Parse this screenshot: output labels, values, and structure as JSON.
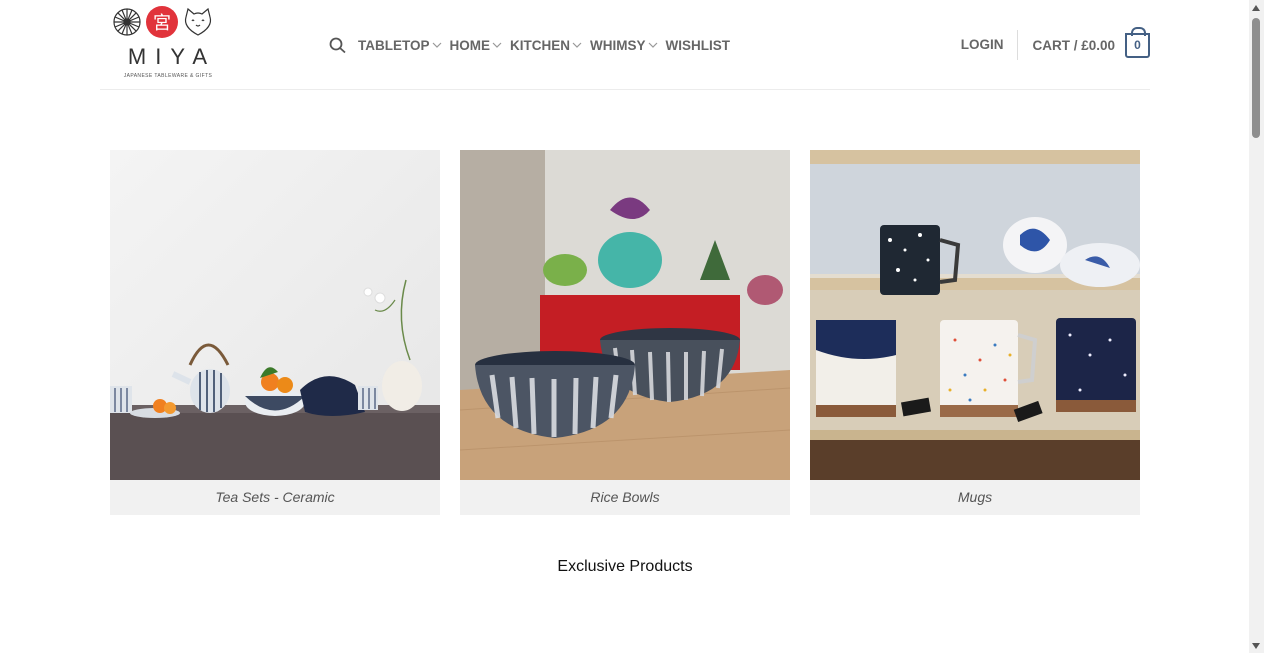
{
  "brand": {
    "name": "MIYA",
    "tagline": "JAPANESE TABLEWARE & GIFTS",
    "kanji": "宮"
  },
  "nav": {
    "search_icon": "search-icon",
    "items": [
      {
        "label": "TABLETOP",
        "dropdown": true
      },
      {
        "label": "HOME",
        "dropdown": true
      },
      {
        "label": "KITCHEN",
        "dropdown": true
      },
      {
        "label": "WHIMSY",
        "dropdown": true
      },
      {
        "label": "WISHLIST",
        "dropdown": false
      }
    ]
  },
  "account": {
    "login_label": "LOGIN"
  },
  "cart": {
    "label": "CART / £0.00",
    "count": "0"
  },
  "categories": [
    {
      "caption": "Tea Sets - Ceramic"
    },
    {
      "caption": "Rice Bowls"
    },
    {
      "caption": "Mugs"
    }
  ],
  "section": {
    "title": "Exclusive Products"
  },
  "colors": {
    "accent": "#446084",
    "nav_text": "#666666",
    "logo_red": "#e1333b",
    "caption_bg": "#f1f1f1"
  }
}
